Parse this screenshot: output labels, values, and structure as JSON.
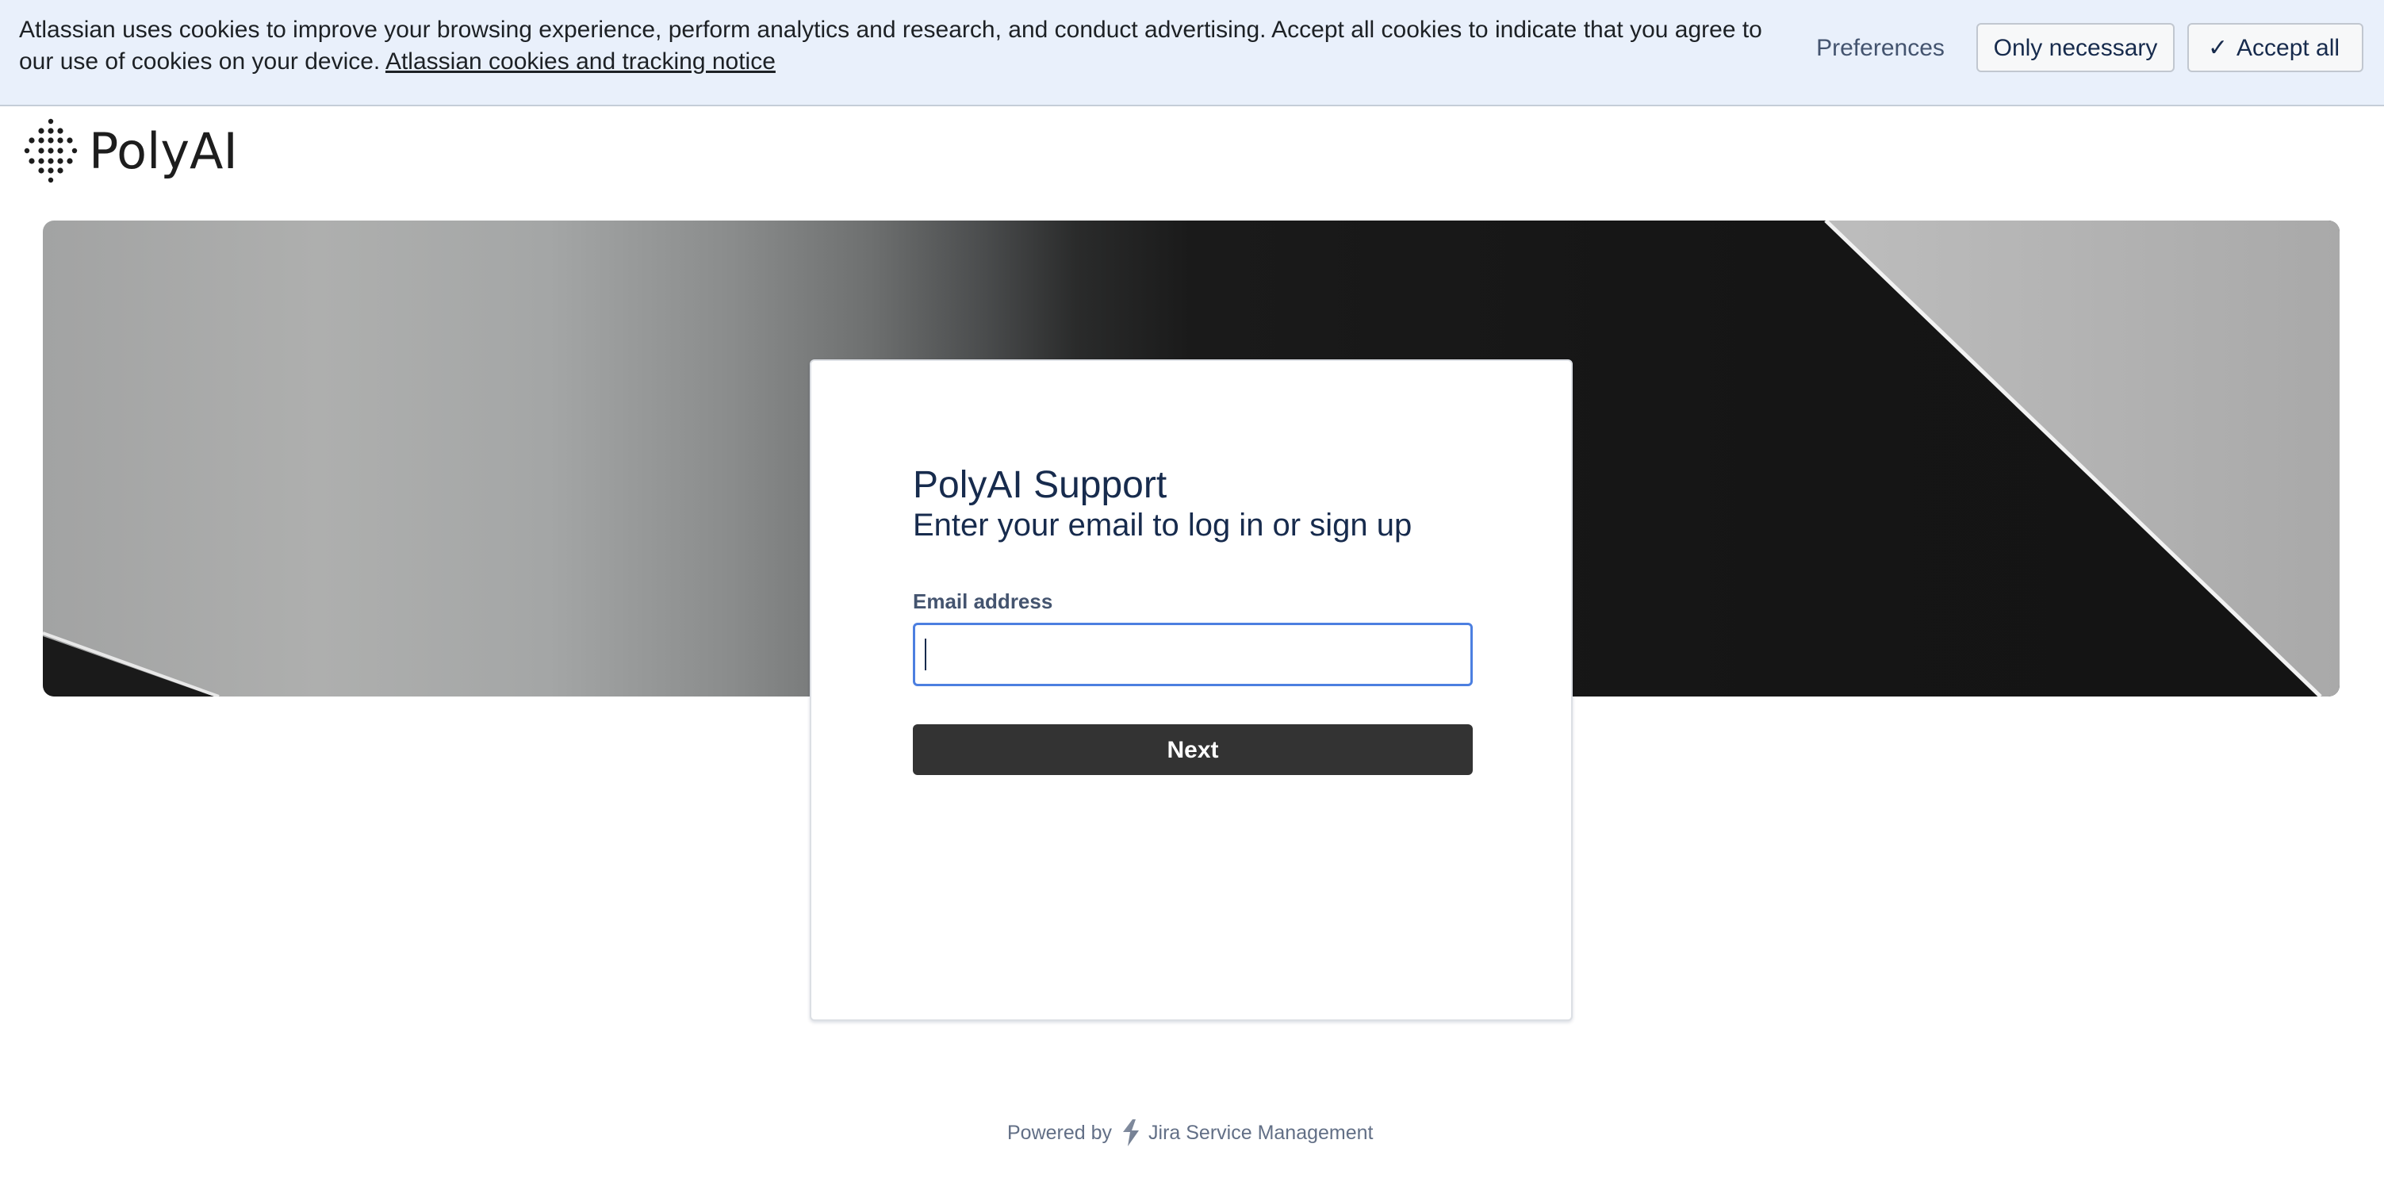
{
  "cookie_banner": {
    "message": "Atlassian uses cookies to improve your browsing experience, perform analytics and research, and conduct advertising. Accept all cookies to indicate that you agree to our use of cookies on your device.",
    "notice_link": "Atlassian cookies and tracking notice",
    "preferences_label": "Preferences",
    "only_necessary_label": "Only necessary",
    "accept_all_label": "Accept all",
    "accept_icon": "check-icon"
  },
  "header": {
    "logo_text": "PolyAI",
    "logo_icon": "polyai-dots-logo"
  },
  "login_card": {
    "title": "PolyAI Support",
    "subtitle": "Enter your email to log in or sign up",
    "email_label": "Email address",
    "email_value": "",
    "email_placeholder": "",
    "next_label": "Next"
  },
  "footer": {
    "powered_by": "Powered by",
    "product_icon": "jira-service-management-icon",
    "product_name": "Jira Service Management"
  },
  "colors": {
    "banner_bg": "#e9f0fb",
    "input_focus_border": "#4c7fe0",
    "next_button_bg": "#333333",
    "text_primary": "#172b4d"
  }
}
